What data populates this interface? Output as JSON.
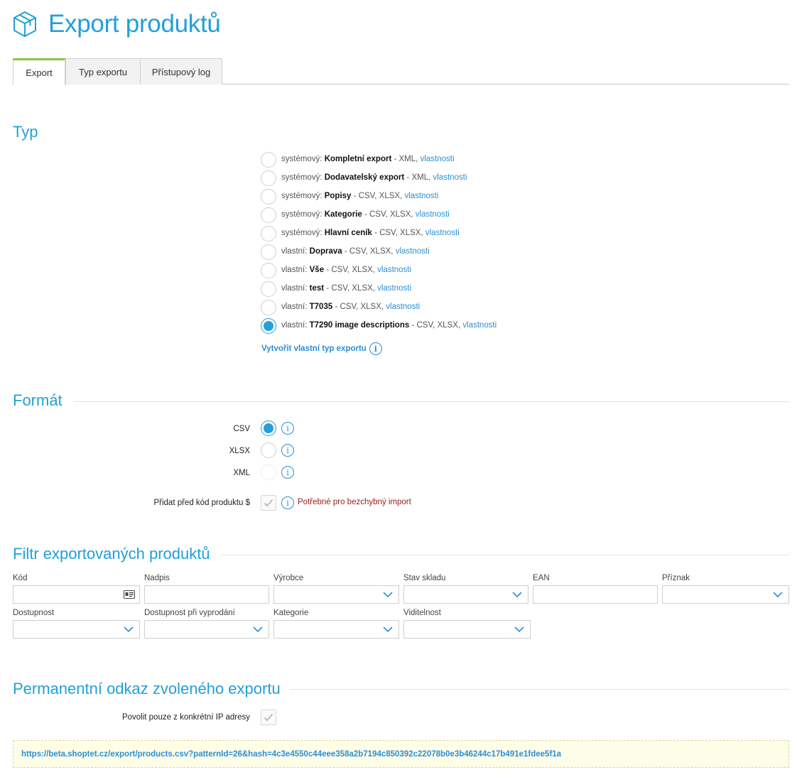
{
  "page": {
    "title": "Export produktů",
    "icon": "box-icon"
  },
  "tabs": [
    {
      "label": "Export",
      "active": true
    },
    {
      "label": "Typ exportu",
      "active": false
    },
    {
      "label": "Přístupový log",
      "active": false
    }
  ],
  "typ": {
    "title": "Typ",
    "options": [
      {
        "prefix": "systémový:",
        "name": "Kompletní export",
        "formats": "- XML,",
        "link": "vlastnosti",
        "selected": false
      },
      {
        "prefix": "systémový:",
        "name": "Dodavatelský export",
        "formats": "- XML,",
        "link": "vlastnosti",
        "selected": false
      },
      {
        "prefix": "systémový:",
        "name": "Popisy",
        "formats": "- CSV, XLSX,",
        "link": "vlastnosti",
        "selected": false
      },
      {
        "prefix": "systémový:",
        "name": "Kategorie",
        "formats": "- CSV, XLSX,",
        "link": "vlastnosti",
        "selected": false
      },
      {
        "prefix": "systémový:",
        "name": "Hlavní ceník",
        "formats": "- CSV, XLSX,",
        "link": "vlastnosti",
        "selected": false
      },
      {
        "prefix": "vlastní:",
        "name": "Doprava",
        "formats": "- CSV, XLSX,",
        "link": "vlastnosti",
        "selected": false
      },
      {
        "prefix": "vlastní:",
        "name": "Vše",
        "formats": "- CSV, XLSX,",
        "link": "vlastnosti",
        "selected": false
      },
      {
        "prefix": "vlastní:",
        "name": "test",
        "formats": "- CSV, XLSX,",
        "link": "vlastnosti",
        "selected": false
      },
      {
        "prefix": "vlastní:",
        "name": "T7035",
        "formats": "- CSV, XLSX,",
        "link": "vlastnosti",
        "selected": false
      },
      {
        "prefix": "vlastní:",
        "name": "T7290 image descriptions",
        "formats": "- CSV, XLSX,",
        "link": "vlastnosti",
        "selected": true
      }
    ],
    "create_link": "Vytvořit vlastní typ exportu"
  },
  "format": {
    "title": "Formát",
    "options": [
      {
        "label": "CSV",
        "selected": true
      },
      {
        "label": "XLSX",
        "selected": false
      },
      {
        "label": "XML",
        "selected": false
      }
    ],
    "prefix_label": "Přidat před kód produktu $",
    "prefix_note": "Potřebné pro bezchybný import",
    "prefix_checked": true
  },
  "filter": {
    "title": "Filtr exportovaných produktů",
    "fields": [
      {
        "label": "Kód",
        "value": ""
      },
      {
        "label": "Nadpis",
        "value": ""
      },
      {
        "label": "Výrobce",
        "value": ""
      },
      {
        "label": "Stav skladu",
        "value": ""
      },
      {
        "label": "EAN",
        "value": ""
      },
      {
        "label": "Příznak",
        "value": ""
      },
      {
        "label": "Dostupnost",
        "value": ""
      },
      {
        "label": "Dostupnost při vyprodání",
        "value": ""
      },
      {
        "label": "Kategorie",
        "value": ""
      },
      {
        "label": "Viditelnost",
        "value": ""
      }
    ]
  },
  "permalink": {
    "title": "Permanentní odkaz zvoleného exportu",
    "ip_label": "Povolit pouze z konkrétní IP adresy",
    "ip_checked": true,
    "url": "https://beta.shoptet.cz/export/products.csv?patternId=26&hash=4c3e4550c44eee358a2b7194c850392c22078b0e3b46244c17b491e1fdee5f1a"
  },
  "colors": {
    "accent": "#22a0d8",
    "link": "#2a8fd6",
    "tab_active": "#8cc63f",
    "warning": "#9b1c1c"
  }
}
